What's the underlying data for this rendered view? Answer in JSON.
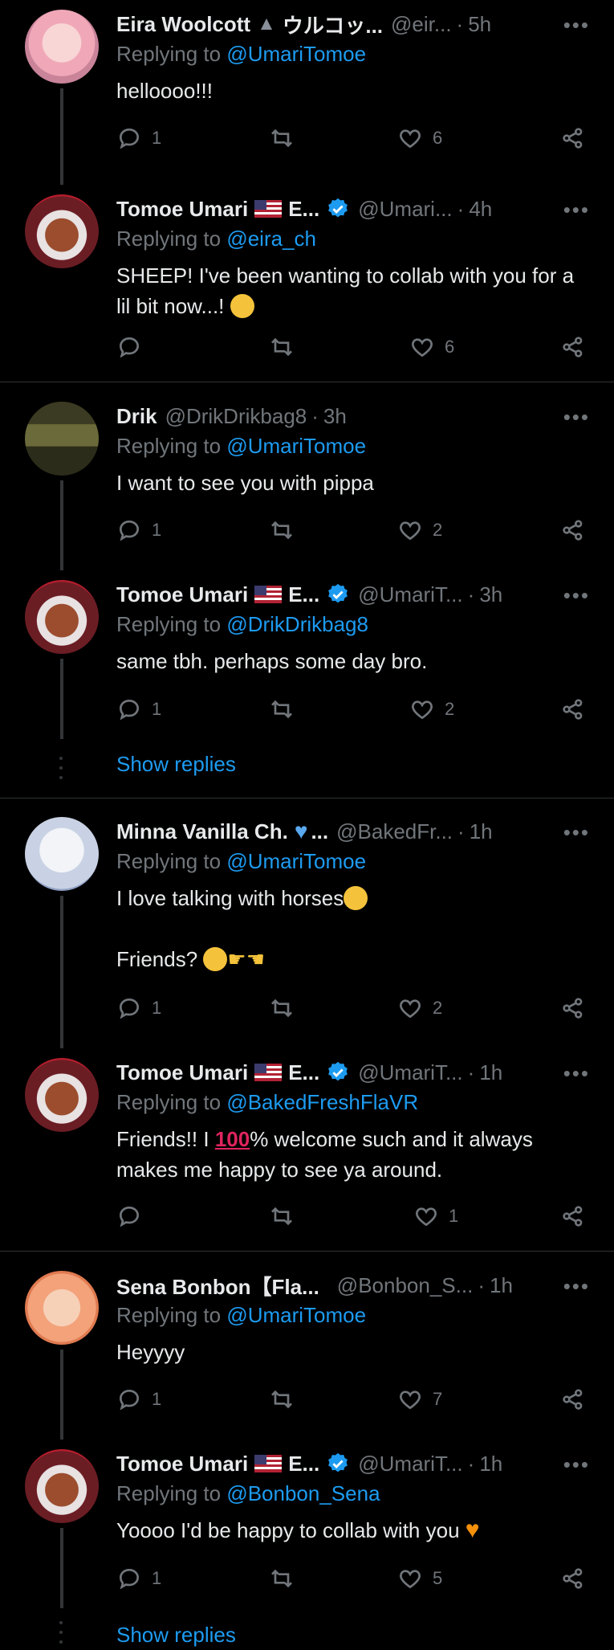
{
  "tweets": [
    {
      "name": "Eira Woolcott",
      "suffix": "ウルコッ...",
      "handle": "@eir...",
      "time": "5h",
      "reply_to": "@UmariTomoe",
      "text": "helloooo!!!",
      "replies": "1",
      "likes": "6",
      "verified": false,
      "flag": false
    },
    {
      "name": "Tomoe Umari",
      "suffix": "E...",
      "handle": "@Umari...",
      "time": "4h",
      "reply_to": "@eira_ch",
      "text": "SHEEP! I've been wanting to collab with you for a lil bit now...!",
      "replies": "",
      "likes": "6",
      "verified": true,
      "flag": true
    },
    {
      "name": "Drik",
      "suffix": "",
      "handle": "@DrikDrikbag8",
      "time": "3h",
      "reply_to": "@UmariTomoe",
      "text": "I want to see you with pippa",
      "replies": "1",
      "likes": "2",
      "verified": false,
      "flag": false
    },
    {
      "name": "Tomoe Umari",
      "suffix": "E...",
      "handle": "@UmariT...",
      "time": "3h",
      "reply_to": "@DrikDrikbag8",
      "text": "same tbh. perhaps some day bro.",
      "replies": "1",
      "likes": "2",
      "verified": true,
      "flag": true
    },
    {
      "name": "Minna Vanilla Ch.",
      "suffix": "...",
      "handle": "@BakedFr...",
      "time": "1h",
      "reply_to": "@UmariTomoe",
      "text": "I love talking with horses",
      "text2": "Friends?",
      "replies": "1",
      "likes": "2",
      "verified": false,
      "flag": false
    },
    {
      "name": "Tomoe Umari",
      "suffix": "E...",
      "handle": "@UmariT...",
      "time": "1h",
      "reply_to": "@BakedFreshFlaVR",
      "text_a": "Friends!! I",
      "text_b": "% welcome such and it always makes me happy to see ya around.",
      "replies": "",
      "likes": "1",
      "verified": true,
      "flag": true
    },
    {
      "name": "Sena Bonbon【Fla...",
      "suffix": "",
      "handle": "@Bonbon_S...",
      "time": "1h",
      "reply_to": "@UmariTomoe",
      "text": "Heyyyy",
      "replies": "1",
      "likes": "7",
      "verified": false,
      "flag": false
    },
    {
      "name": "Tomoe Umari",
      "suffix": "E...",
      "handle": "@UmariT...",
      "time": "1h",
      "reply_to": "@Bonbon_Sena",
      "text": "Yoooo I'd be happy to collab with you",
      "replies": "1",
      "likes": "5",
      "verified": true,
      "flag": true
    }
  ],
  "labels": {
    "replying_to": "Replying to",
    "show_replies": "Show replies",
    "more": "•••",
    "dot": "·"
  },
  "colors": {
    "accent": "#1d9bf0",
    "muted": "#71767b",
    "text": "#e7e9ea",
    "bg": "#000000"
  }
}
